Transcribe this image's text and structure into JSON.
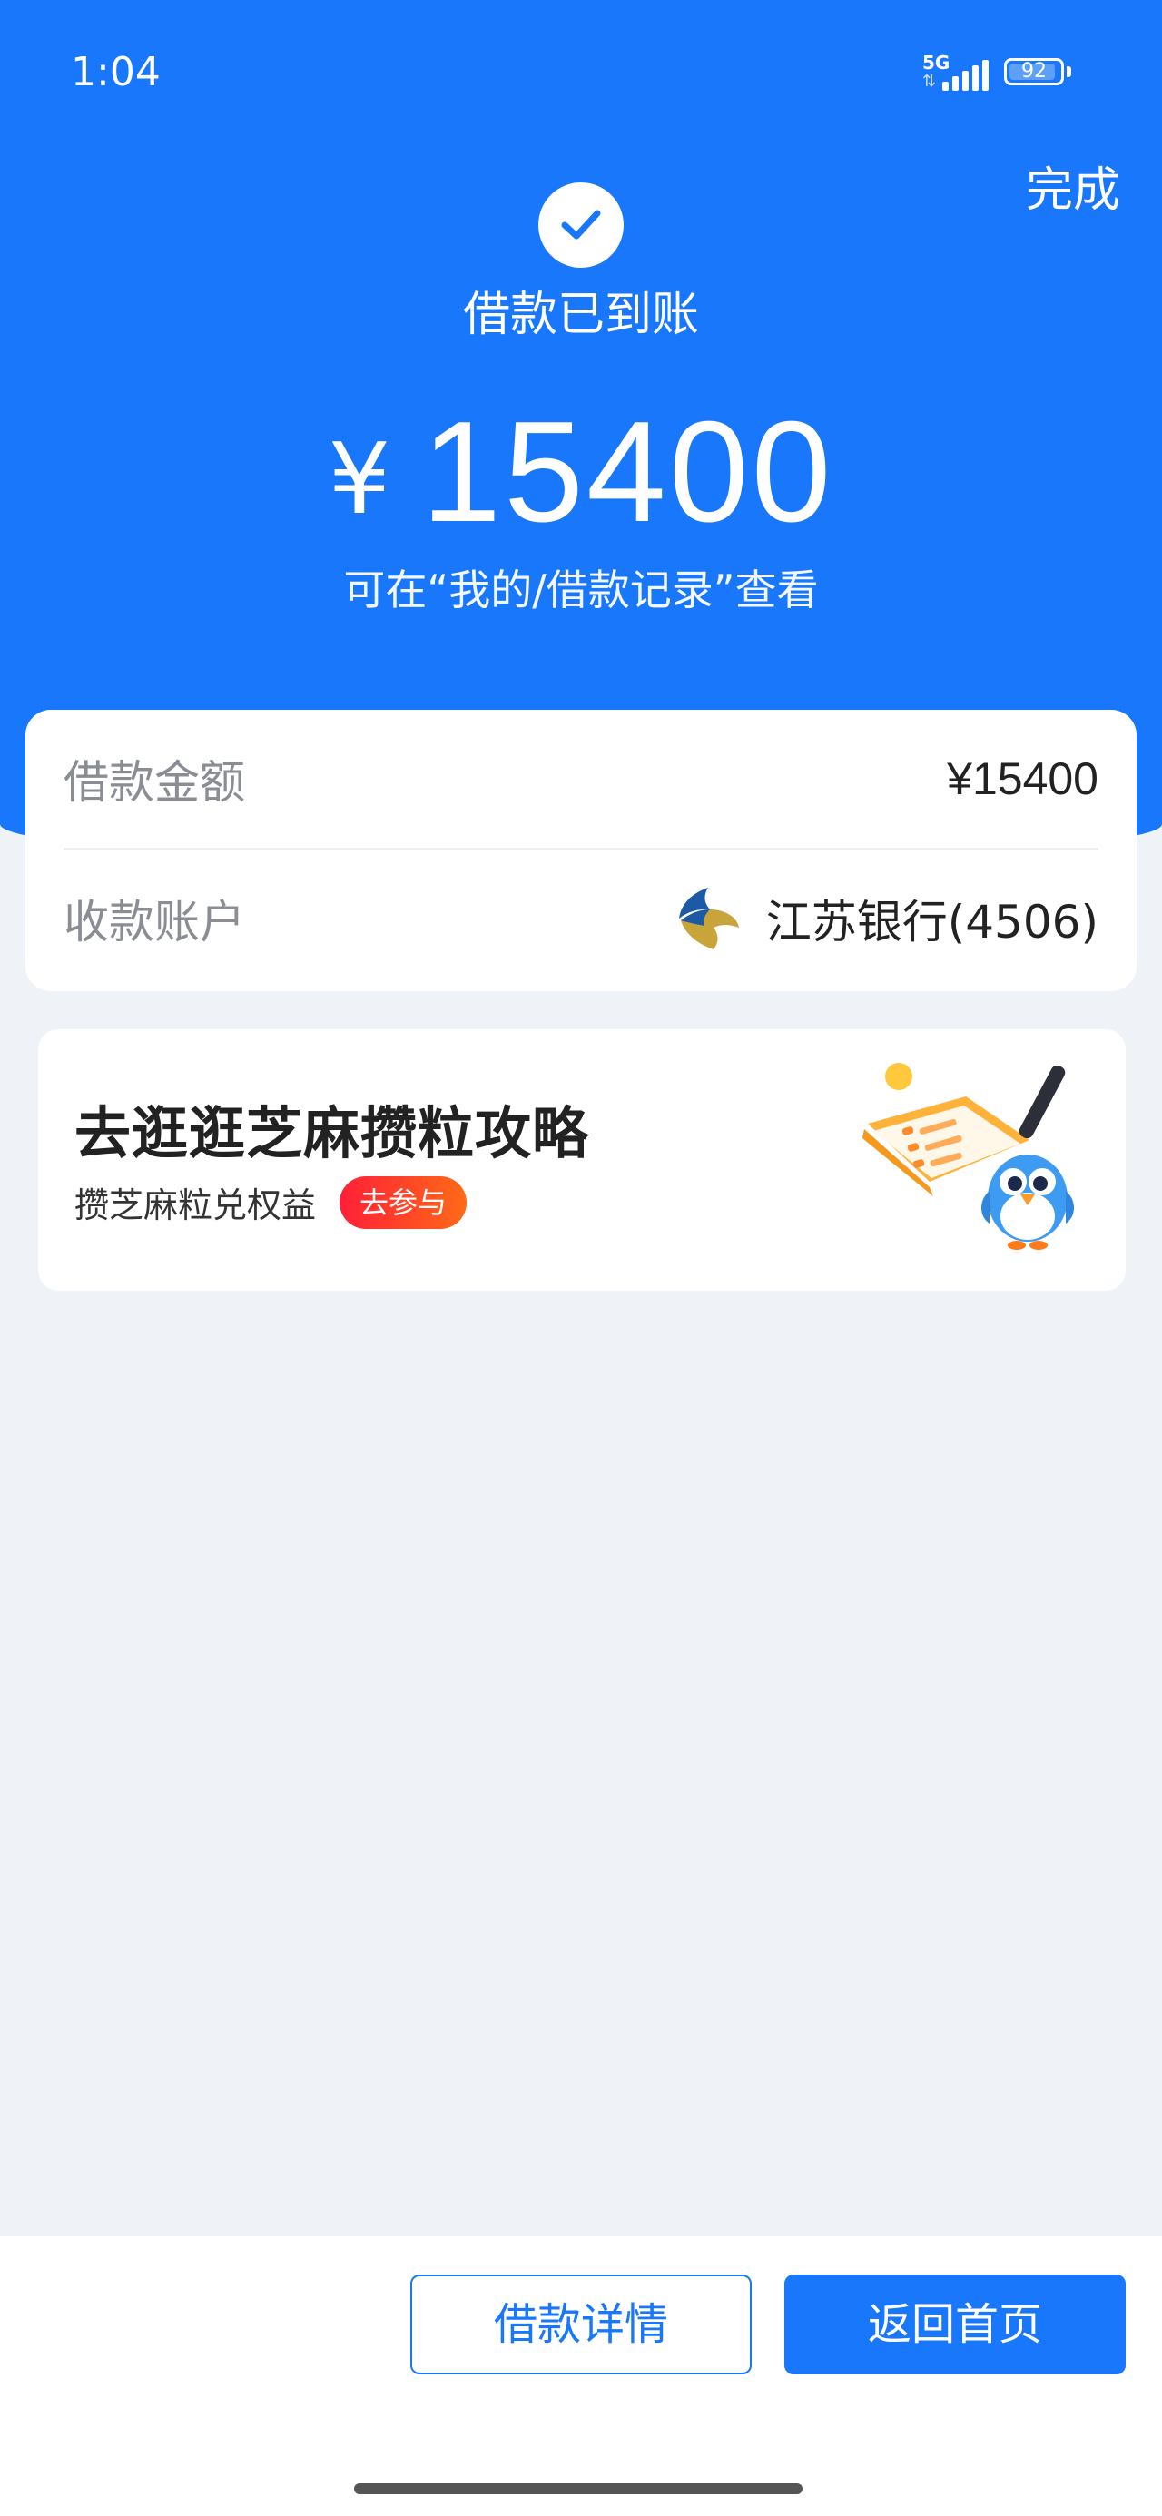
{
  "status_bar": {
    "time": "1:04",
    "network": "5G",
    "battery": "92",
    "battery_level": 0.92
  },
  "header": {
    "done_label": "完成",
    "status_title": "借款已到账",
    "currency_symbol": "¥",
    "amount": "15400",
    "record_hint": "可在“我的/借款记录”查看"
  },
  "info": {
    "amount_label": "借款金额",
    "amount_value": "¥15400",
    "account_label": "收款账户",
    "account_value": "江苏银行(4506)"
  },
  "promo": {
    "title": "去逛逛芝麻攒粒攻略",
    "subtitle": "攒芝麻粒兑权益",
    "badge": "去参与"
  },
  "footer": {
    "details_label": "借款详情",
    "home_label": "返回首页"
  },
  "colors": {
    "brand_blue": "#1877fb",
    "page_bg": "#eff2f7",
    "badge_red": "#ff1f38"
  }
}
